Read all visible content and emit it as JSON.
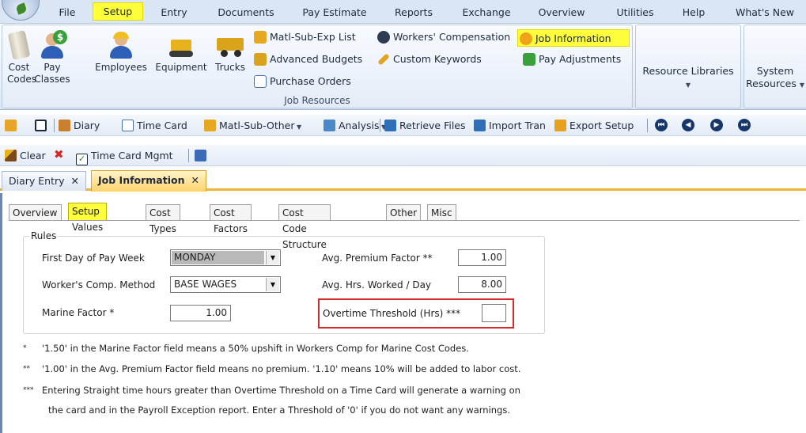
{
  "menu": {
    "items": [
      "File",
      "Setup",
      "Entry",
      "Documents",
      "Pay Estimate",
      "Reports",
      "Exchange",
      "Overview",
      "Utilities",
      "Help",
      "What's New"
    ],
    "active": "Setup"
  },
  "ribbon": {
    "job_resources": {
      "label": "Job Resources",
      "cost_codes": "Cost Codes",
      "pay_classes": "Pay Classes",
      "employees": "Employees",
      "equipment": "Equipment",
      "trucks": "Trucks",
      "matl_sub_exp_list": "Matl-Sub-Exp List",
      "advanced_budgets": "Advanced Budgets",
      "purchase_orders": "Purchase Orders",
      "workers_compensation": "Workers' Compensation",
      "custom_keywords": "Custom Keywords",
      "job_information": "Job Information",
      "pay_adjustments": "Pay Adjustments"
    },
    "resource_libraries": "Resource Libraries",
    "system_resources": "System Resources"
  },
  "toolbar1": {
    "diary": "Diary",
    "time_card": "Time Card",
    "matl_sub_other": "Matl-Sub-Other",
    "analysis": "Analysis",
    "retrieve_files": "Retrieve Files",
    "import_tran": "Import Tran",
    "export_setup": "Export Setup"
  },
  "toolbar2": {
    "clear": "Clear",
    "time_card_mgmt": "Time Card Mgmt"
  },
  "doc_tabs": [
    {
      "label": "Diary Entry",
      "close": "✕"
    },
    {
      "label": "Job Information",
      "close": "✕"
    }
  ],
  "inner_tabs": [
    "Overview",
    "Setup Values",
    "Cost Types",
    "Cost Factors",
    "Cost Code Structure",
    "Other",
    "Misc"
  ],
  "rules": {
    "legend": "Rules",
    "first_day_label": "First Day of Pay Week",
    "first_day_value": "MONDAY",
    "workers_comp_label": "Worker's Comp. Method",
    "workers_comp_value": "BASE WAGES",
    "marine_label": "Marine Factor *",
    "marine_value": "1.00",
    "avg_premium_label": "Avg. Premium Factor **",
    "avg_premium_value": "1.00",
    "avg_hrs_label": "Avg. Hrs. Worked / Day",
    "avg_hrs_value": "8.00",
    "overtime_label": "Overtime Threshold (Hrs) ***",
    "overtime_value": ""
  },
  "notes": {
    "n1_mark": "*",
    "n1": "'1.50' in the Marine Factor field means a 50% upshift in Workers Comp for Marine Cost Codes.",
    "n2_mark": "**",
    "n2": "'1.00' in the Avg. Premium Factor field means no premium.  '1.10' means 10% will be added to labor cost.",
    "n3_mark": "***",
    "n3a": "Entering Straight time hours greater than Overtime Threshold on a Time Card will generate a warning on",
    "n3b": "the card and in the Payroll Exception report.  Enter a Threshold of '0' if you do not want any warnings."
  },
  "colors": {
    "highlight": "#fffe3a",
    "callout_red": "#d42a2a",
    "active_tab": "#ffd36b",
    "ribbon_bg": "#dbe6f4"
  }
}
